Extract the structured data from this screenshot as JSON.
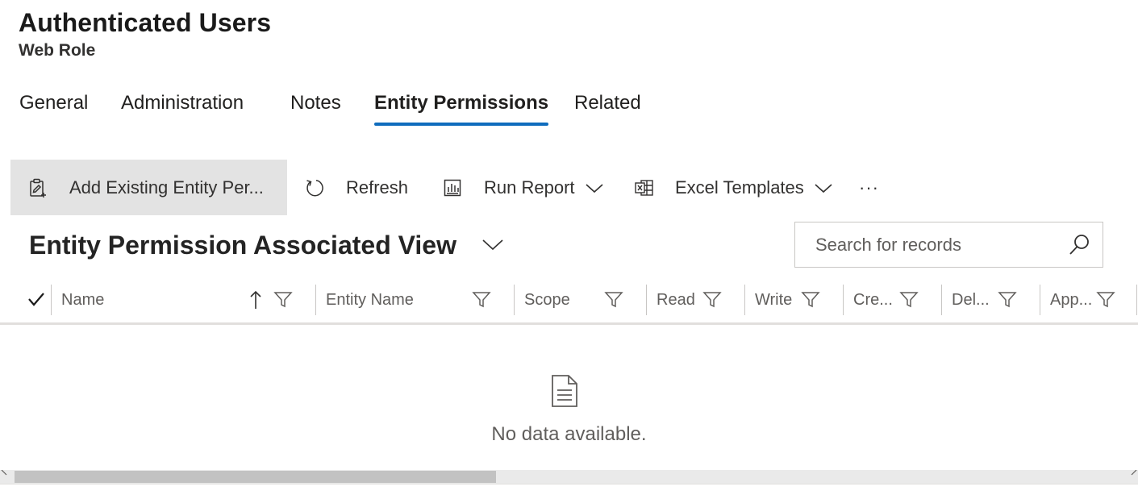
{
  "record": {
    "title": "Authenticated Users",
    "entity_type": "Web Role"
  },
  "tabs": [
    {
      "label": "General",
      "active": false
    },
    {
      "label": "Administration",
      "active": false
    },
    {
      "label": "Notes",
      "active": false
    },
    {
      "label": "Entity Permissions",
      "active": true
    },
    {
      "label": "Related",
      "active": false
    }
  ],
  "commands": {
    "add_existing": {
      "label": "Add Existing Entity Per...",
      "icon": "add-existing-icon"
    },
    "refresh": {
      "label": "Refresh",
      "icon": "refresh-icon"
    },
    "run_report": {
      "label": "Run Report",
      "icon": "report-icon"
    },
    "excel_templates": {
      "label": "Excel Templates",
      "icon": "excel-icon"
    },
    "more": {
      "label": "···"
    }
  },
  "view": {
    "title": "Entity Permission Associated View"
  },
  "search": {
    "placeholder": "Search for records"
  },
  "grid": {
    "columns": [
      {
        "label": "Name",
        "sorted": "ascending"
      },
      {
        "label": "Entity Name"
      },
      {
        "label": "Scope"
      },
      {
        "label": "Read"
      },
      {
        "label": "Write"
      },
      {
        "label": "Cre..."
      },
      {
        "label": "Del..."
      },
      {
        "label": "App..."
      }
    ],
    "empty_message": "No data available."
  },
  "colors": {
    "accent": "#0f6cbd",
    "command_selected_bg": "#e3e3e3",
    "scroll_thumb": "#c2c2c2"
  }
}
